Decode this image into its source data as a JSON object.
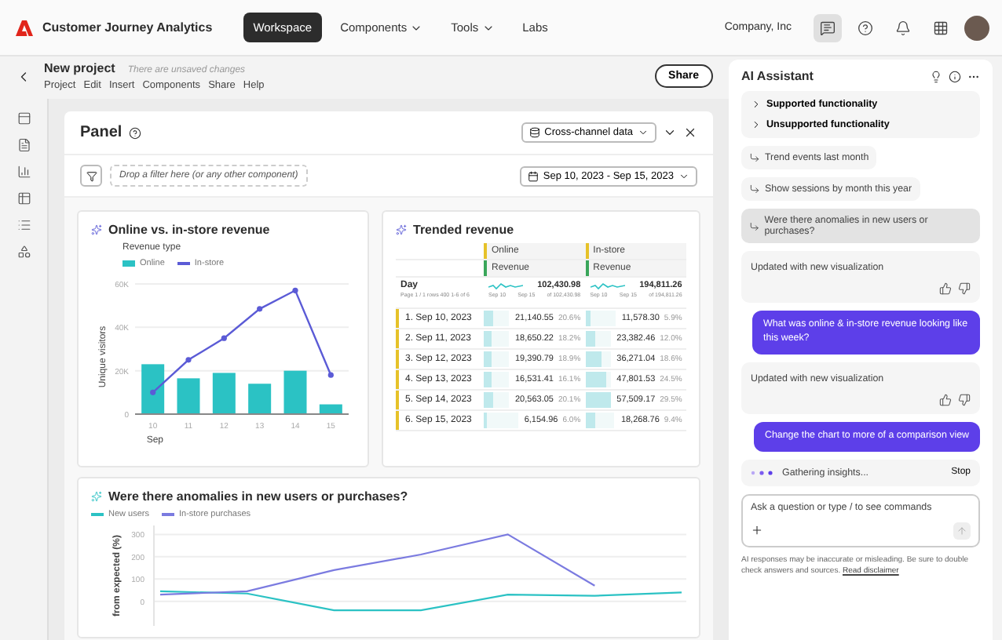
{
  "topbar": {
    "product": "Customer Journey Analytics",
    "nav": [
      {
        "label": "Workspace",
        "selected": true,
        "dropdown": false
      },
      {
        "label": "Components",
        "selected": false,
        "dropdown": true
      },
      {
        "label": "Tools",
        "selected": false,
        "dropdown": true
      },
      {
        "label": "Labs",
        "selected": false,
        "dropdown": false
      }
    ],
    "org": "Company, Inc"
  },
  "project": {
    "title": "New project",
    "status": "There are unsaved changes",
    "menu": [
      "Project",
      "Edit",
      "Insert",
      "Components",
      "Share",
      "Help"
    ],
    "share": "Share"
  },
  "panel": {
    "title": "Panel",
    "data_view": "Cross-channel data",
    "filter_placeholder": "Drop a filter here (or any other component)",
    "date_range": "Sep 10, 2023 - Sep 15, 2023",
    "chart1": {
      "title": "Online vs. in-store revenue",
      "legend_title": "Revenue type",
      "chart_data": {
        "type": "bar",
        "ylabel": "Unique visitors",
        "xlabel": "Sep",
        "categories": [
          "10",
          "11",
          "12",
          "13",
          "14",
          "15"
        ],
        "yticks": [
          {
            "value": 0,
            "label": "0"
          },
          {
            "value": 20000,
            "label": "20K"
          },
          {
            "value": 40000,
            "label": "40K"
          },
          {
            "value": 60000,
            "label": "60K"
          }
        ],
        "ylim": [
          0,
          60000
        ],
        "grid": true,
        "series": [
          {
            "name": "Online",
            "type": "bar",
            "color": "#2bc2c4",
            "values": [
              23000,
              16500,
              19000,
              14000,
              20000,
              4500
            ]
          },
          {
            "name": "In-store",
            "type": "line",
            "marker": true,
            "color": "#5b5bd6",
            "values": [
              10000,
              25000,
              35000,
              48500,
              57000,
              18000
            ]
          }
        ]
      }
    },
    "table": {
      "title": "Trended revenue",
      "day_header": "Day",
      "day_sub": "Page 1 / 1 rows 400 1-6 of 6",
      "columns": [
        {
          "group": "Online",
          "metric": "Revenue",
          "total": "102,430.98",
          "from": "Sep 10",
          "to": "Sep 15",
          "of": "of 102,430.98"
        },
        {
          "group": "In-store",
          "metric": "Revenue",
          "total": "194,811.26",
          "from": "Sep 10",
          "to": "Sep 15",
          "of": "of 194,811.26"
        }
      ],
      "rows": [
        {
          "day": "1. Sep 10, 2023",
          "cells": [
            {
              "value": "21,140.55",
              "pct": "20.6%",
              "level": 0.37
            },
            {
              "value": "11,578.30",
              "pct": "5.9%",
              "level": 0.2
            }
          ]
        },
        {
          "day": "2. Sep 11, 2023",
          "cells": [
            {
              "value": "18,650.22",
              "pct": "18.2%",
              "level": 0.33
            },
            {
              "value": "23,382.46",
              "pct": "12.0%",
              "level": 0.4
            }
          ]
        },
        {
          "day": "3. Sep 12, 2023",
          "cells": [
            {
              "value": "19,390.79",
              "pct": "18.9%",
              "level": 0.34
            },
            {
              "value": "36,271.04",
              "pct": "18.6%",
              "level": 0.63
            }
          ]
        },
        {
          "day": "4. Sep 13, 2023",
          "cells": [
            {
              "value": "16,531.41",
              "pct": "16.1%",
              "level": 0.29
            },
            {
              "value": "47,801.53",
              "pct": "24.5%",
              "level": 0.83
            }
          ]
        },
        {
          "day": "5. Sep 14, 2023",
          "cells": [
            {
              "value": "20,563.05",
              "pct": "20.1%",
              "level": 0.36
            },
            {
              "value": "57,509.17",
              "pct": "29.5%",
              "level": 1.0
            }
          ]
        },
        {
          "day": "6. Sep 15, 2023",
          "cells": [
            {
              "value": "6,154.96",
              "pct": "6.0%",
              "level": 0.11
            },
            {
              "value": "18,268.76",
              "pct": "9.4%",
              "level": 0.32
            }
          ]
        }
      ]
    },
    "chart3": {
      "title": "Were there anomalies in new users or purchases?",
      "chart_data": {
        "type": "line",
        "ylabel": "from expected (%)",
        "yticks": [
          0,
          100,
          200,
          300
        ],
        "ylim": [
          -110,
          340
        ],
        "grid": true,
        "series": [
          {
            "name": "New users",
            "color": "#2bc2c4",
            "values": [
              45,
              35,
              -40,
              -40,
              30,
              25,
              40
            ]
          },
          {
            "name": "In-store purchases",
            "color": "#7b7be0",
            "values": [
              30,
              45,
              140,
              210,
              300,
              70,
              null
            ]
          }
        ]
      }
    }
  },
  "assistant": {
    "title": "AI Assistant",
    "help": [
      {
        "label": "Supported functionality",
        "expanded": false
      },
      {
        "label": "Unsupported functionality",
        "expanded": false
      }
    ],
    "suggestions": [
      {
        "label": "Trend events last month",
        "selected": false
      },
      {
        "label": "Show sessions by month this year",
        "selected": false
      },
      {
        "label": "Were there anomalies in new users or purchases?",
        "selected": true
      }
    ],
    "messages": [
      {
        "kind": "assistant",
        "text": "Updated with new visualization"
      },
      {
        "kind": "user",
        "text": "What was online & in-store revenue looking like this week?"
      },
      {
        "kind": "assistant",
        "text": "Updated with new visualization"
      },
      {
        "kind": "user",
        "text": "Change the chart to more of a comparison view"
      },
      {
        "kind": "status",
        "text": "Gathering insights...",
        "action": "Stop"
      }
    ],
    "input_placeholder": "Ask a question or type / to see commands",
    "disclaimer": "AI responses may be inaccurate or misleading. Be sure to double check answers and sources.",
    "disclaimer_link": "Read disclaimer"
  }
}
